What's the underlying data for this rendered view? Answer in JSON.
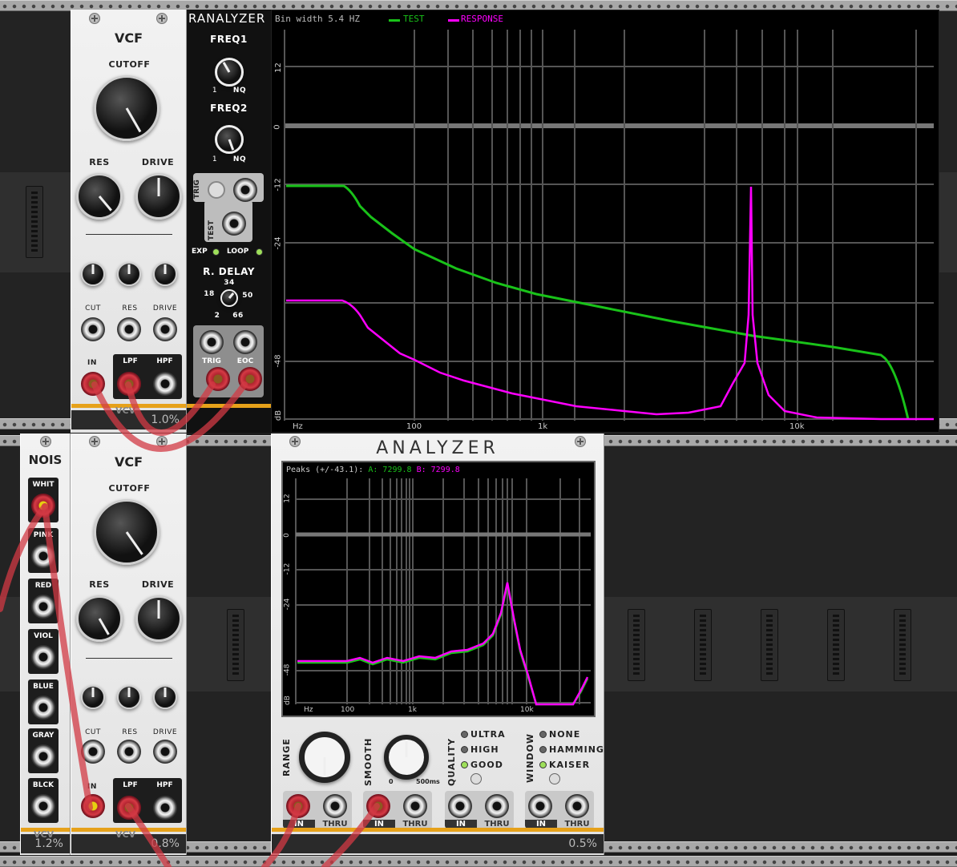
{
  "colors": {
    "test": "#19c219",
    "response": "#ff00ff",
    "cable": "#d13a44",
    "accent": "#e6a11a"
  },
  "vcf_top": {
    "title": "VCF",
    "cutoff": "CUTOFF",
    "res": "RES",
    "drive": "DRIVE",
    "cv_cut": "CUT",
    "cv_res": "RES",
    "cv_drive": "DRIVE",
    "in": "IN",
    "lpf": "LPF",
    "hpf": "HPF",
    "brand": "VCV",
    "percent": "1.0%"
  },
  "ranalyzer": {
    "title": "RANALYZER",
    "freq1": "FREQ1",
    "freq2": "FREQ2",
    "f_min": "1",
    "f_max": "NQ",
    "f2_min": "1",
    "f2_max": "NQ",
    "trig": "TRIG",
    "test": "TEST",
    "exp": "EXP",
    "loop": "LOOP",
    "rdelay": "R. DELAY",
    "d34": "34",
    "d18": "18",
    "d50": "50",
    "d2": "2",
    "d66": "66",
    "out_trig": "TRIG",
    "out_eoc": "EOC",
    "bin": "Bin width 5.4 HZ",
    "legend_test": "TEST",
    "legend_resp": "RESPONSE",
    "y_ticks": [
      "12",
      "0",
      "-12",
      "-24",
      "-48",
      "dB"
    ],
    "x_ticks": [
      "Hz",
      "100",
      "1k",
      "10k"
    ]
  },
  "nois": {
    "title": "NOIS",
    "whit": "WHIT",
    "pink": "PINK",
    "red": "RED",
    "viol": "VIOL",
    "blue": "BLUE",
    "gray": "GRAY",
    "blck": "BLCK",
    "brand": "VCV",
    "percent": "1.2%"
  },
  "vcf_bot": {
    "title": "VCF",
    "cutoff": "CUTOFF",
    "res": "RES",
    "drive": "DRIVE",
    "cv_cut": "CUT",
    "cv_res": "RES",
    "cv_drive": "DRIVE",
    "in": "IN",
    "lpf": "LPF",
    "hpf": "HPF",
    "brand": "VCV",
    "percent": "0.8%"
  },
  "analyzer": {
    "title": "ANALYZER",
    "peaks_label": "Peaks (+/-43.1):",
    "peak_a": "A: 7299.8",
    "peak_b": "B: 7299.8",
    "y_ticks": [
      "12",
      "0",
      "-12",
      "-24",
      "-48",
      "dB"
    ],
    "x_ticks": [
      "Hz",
      "100",
      "1k",
      "10k"
    ],
    "range": "RANGE",
    "smooth": "SMOOTH",
    "s_min": "0",
    "s_max": "500ms",
    "quality": "QUALITY",
    "q_ultra": "ULTRA",
    "q_high": "HIGH",
    "q_good": "GOOD",
    "window": "WINDOW",
    "w_none": "NONE",
    "w_hamming": "HAMMING",
    "w_kaiser": "KAISER",
    "in1": "IN",
    "thru1": "THRU",
    "in2": "IN",
    "thru2": "THRU",
    "in3": "IN",
    "thru3": "THRU",
    "in4": "IN",
    "thru4": "THRU",
    "percent": "0.5%"
  }
}
